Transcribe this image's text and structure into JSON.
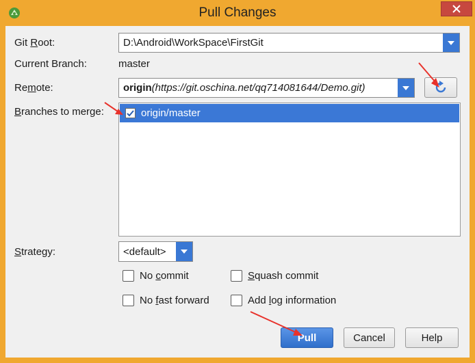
{
  "window": {
    "title": "Pull Changes",
    "close_glyph": "×"
  },
  "form": {
    "git_root": {
      "label_pre": "Git ",
      "label_key": "R",
      "label_post": "oot:",
      "value": "D:\\Android\\WorkSpace\\FirstGit"
    },
    "current_branch": {
      "label": "Current Branch:",
      "value": "master"
    },
    "remote": {
      "label_pre": "Re",
      "label_key": "m",
      "label_post": "ote:",
      "name": "origin",
      "url": "(https://git.oschina.net/qq714081644/Demo.git)"
    },
    "branches": {
      "label_pre": "",
      "label_key": "B",
      "label_post": "ranches to merge:",
      "items": [
        {
          "label": "origin/master",
          "checked": true
        }
      ]
    },
    "strategy": {
      "label_pre": "",
      "label_key": "S",
      "label_post": "trategy:",
      "value": "<default>"
    }
  },
  "options": {
    "no_commit": {
      "pre": "No ",
      "key": "c",
      "post": "ommit",
      "checked": false
    },
    "squash_commit": {
      "pre": "",
      "key": "S",
      "post": "quash commit",
      "checked": false
    },
    "no_fast_forward": {
      "pre": "No ",
      "key": "f",
      "post": "ast forward",
      "checked": false
    },
    "add_log": {
      "pre": "Add ",
      "key": "l",
      "post": "og information",
      "checked": false
    }
  },
  "buttons": {
    "pull": "Pull",
    "cancel": "Cancel",
    "help": "Help"
  },
  "colors": {
    "accent": "#3b78d6",
    "annotation": "#e8322b",
    "title_bar": "#f0a830"
  }
}
